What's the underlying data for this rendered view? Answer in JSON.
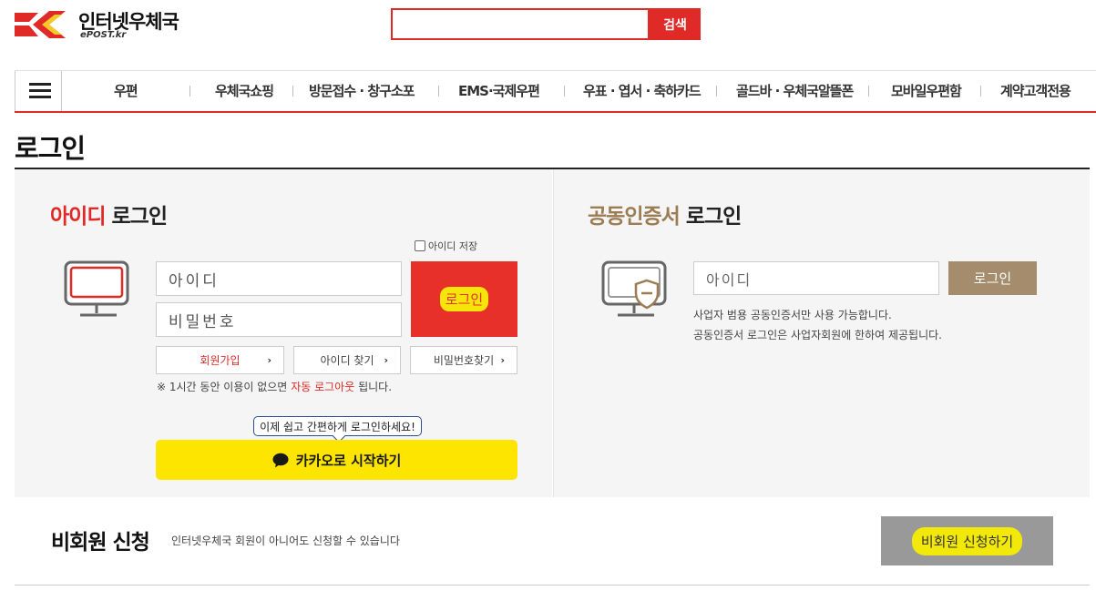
{
  "header": {
    "logo_title": "인터넷우체국",
    "logo_sub": "ePOST.kr",
    "search_button": "검색",
    "brand_color": "#e02a27"
  },
  "nav": {
    "items": [
      "우편",
      "우체국쇼핑",
      "방문접수 · 창구소포",
      "EMS·국제우편",
      "우표 · 엽서 · 축하카드",
      "골드바 · 우체국알뜰폰",
      "모바일우편함",
      "계약고객전용"
    ]
  },
  "page": {
    "title": "로그인"
  },
  "id_login": {
    "heading_red": "아이디",
    "heading_rest": "로그인",
    "save_id_label": "아이디 저장",
    "id_placeholder": "아이디",
    "pw_placeholder": "비밀번호",
    "login_button": "로그인",
    "join_button": "회원가입",
    "find_id_button": "아이디 찾기",
    "find_pw_button": "비밀번호찾기",
    "notice_prefix": "※ 1시간 동안 이용이 없으면",
    "notice_red": "자동 로그아웃",
    "notice_suffix": "됩니다.",
    "tooltip": "이제 쉽고 간편하게 로그인하세요!",
    "kakao_button": "카카오로 시작하기"
  },
  "cert_login": {
    "heading_brown": "공동인증서",
    "heading_rest": "로그인",
    "id_placeholder": "아이디",
    "login_button": "로그인",
    "note_1": "사업자 범용 공동인증서만 사용 가능합니다.",
    "note_2": "공동인증서 로그인은 사업자회원에 한하여 제공됩니다."
  },
  "nonmember": {
    "title": "비회원 신청",
    "desc": "인터넷우체국 회원이 아니어도 신청할 수 있습니다",
    "button": "비회원 신청하기"
  }
}
